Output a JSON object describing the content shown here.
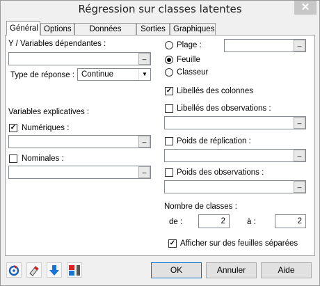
{
  "window": {
    "title": "Régression sur classes latentes",
    "close_glyph": "✕"
  },
  "tabs": [
    {
      "label": "Général",
      "active": true
    },
    {
      "label": "Options",
      "active": false
    },
    {
      "label": "Données manq.",
      "active": false
    },
    {
      "label": "Sorties",
      "active": false
    },
    {
      "label": "Graphiques",
      "active": false
    }
  ],
  "general": {
    "dependents_label": "Y / Variables dépendantes :",
    "response_type_label": "Type de réponse :",
    "response_type_value": "Continue",
    "explanatory_label": "Variables explicatives :",
    "numeric_label": "Numériques :",
    "numeric_checked": true,
    "nominal_label": "Nominales :",
    "nominal_checked": false,
    "range_label": "Plage :",
    "sheet_label": "Feuille",
    "workbook_label": "Classeur",
    "output_selected": "Feuille",
    "col_labels_label": "Libellés des colonnes",
    "col_labels_checked": true,
    "obs_labels_label": "Libellés des observations :",
    "obs_labels_checked": false,
    "replication_weights_label": "Poids de réplication :",
    "replication_weights_checked": false,
    "obs_weights_label": "Poids des observations :",
    "obs_weights_checked": false,
    "num_classes_label": "Nombre de classes :",
    "from_label": "de :",
    "from_value": "2",
    "to_label": "à :",
    "to_value": "2",
    "separate_sheets_label": "Afficher sur des feuilles séparées",
    "separate_sheets_checked": true,
    "picker_glyph": "_"
  },
  "footer": {
    "ok_label": "OK",
    "cancel_label": "Annuler",
    "help_label": "Aide",
    "tools": [
      "reset-icon",
      "eraser-icon",
      "down-arrow-icon",
      "layout-icon"
    ]
  },
  "colors": {
    "accent": "#0078d7",
    "arrow_blue": "#1a73d9",
    "red": "#e02020"
  }
}
